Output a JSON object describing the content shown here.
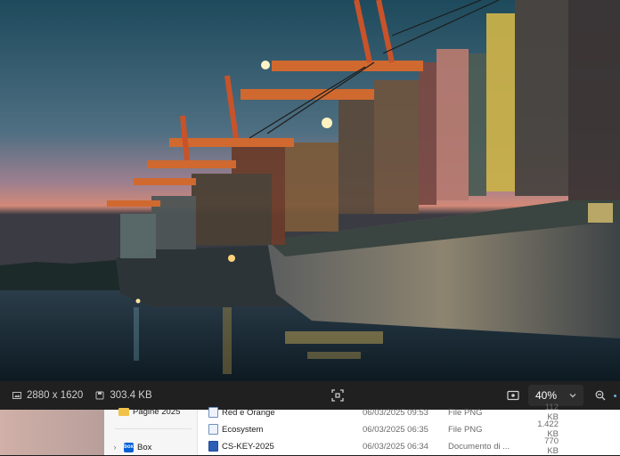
{
  "viewer": {
    "resolution": "2880 x 1620",
    "file_size": "303.4 KB",
    "zoom_value": "40%"
  },
  "explorer": {
    "nav": [
      {
        "label": "Pagine 2025",
        "icon": "folder-icon"
      },
      {
        "label": "Box",
        "icon": "box-logo-icon"
      }
    ],
    "files": [
      {
        "name": "Red e Orange",
        "date": "06/03/2025 09:53",
        "type": "File PNG",
        "size": "112 KB",
        "icon": "png-file-icon"
      },
      {
        "name": "Ecosystem",
        "date": "06/03/2025 06:35",
        "type": "File PNG",
        "size": "1.422 KB",
        "icon": "png-file-icon"
      },
      {
        "name": "CS-KEY-2025",
        "date": "06/03/2025 06:34",
        "type": "Documento di ...",
        "size": "770 KB",
        "icon": "word-doc-icon"
      }
    ]
  },
  "colors": {
    "viewer_bar": "#202020",
    "accent": "#6ab0d9",
    "box_brand": "#0061d5"
  }
}
